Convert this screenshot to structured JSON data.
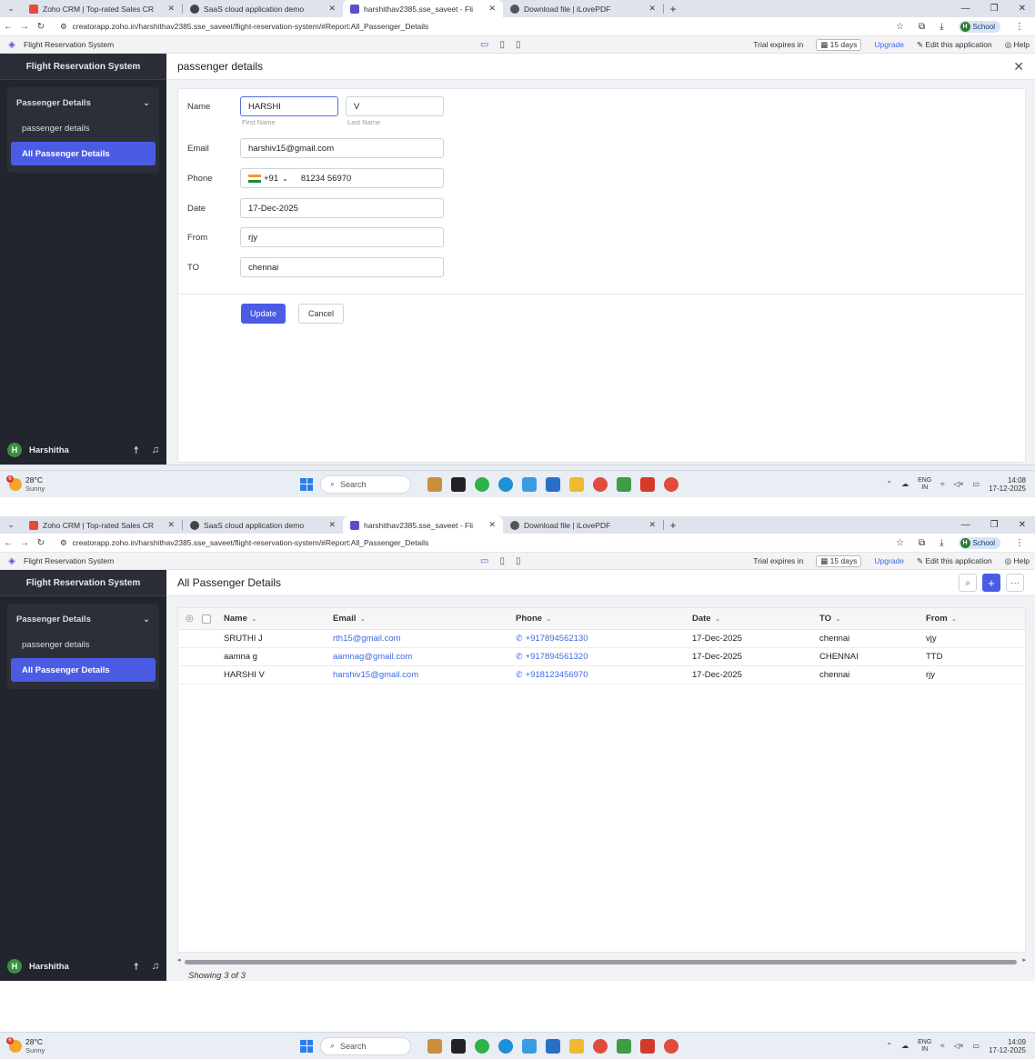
{
  "browser": {
    "tabs": [
      {
        "title": "Zoho CRM | Top-rated Sales CR",
        "color": "#e84a3a"
      },
      {
        "title": "SaaS cloud application demo",
        "color": "#444444"
      },
      {
        "title": "harshithav2385.sse_saveet - Fli",
        "color": "#5a4fcf"
      },
      {
        "title": "Download file | iLovePDF",
        "color": "#555555"
      }
    ],
    "url": "creatorapp.zoho.in/harshithav2385.sse_saveet/flight-reservation-system/#Report:All_Passenger_Details",
    "profile_label": "School",
    "profile_initial": "H"
  },
  "app": {
    "name": "Flight Reservation System",
    "trial_text": "Trial expires in",
    "trial_days": "15 days",
    "upgrade": "Upgrade",
    "edit_app": "Edit this application",
    "help": "Help"
  },
  "sidebar": {
    "title": "Flight Reservation System",
    "group": "Passenger Details",
    "items": [
      "passenger details",
      "All Passenger Details"
    ],
    "user": "Harshitha",
    "user_initial": "H"
  },
  "form": {
    "title": "passenger details",
    "labels": {
      "name": "Name",
      "email": "Email",
      "phone": "Phone",
      "date": "Date",
      "from": "From",
      "to": "TO"
    },
    "first_name": "HARSHI",
    "last_name": "V",
    "first_name_hint": "First Name",
    "last_name_hint": "Last Name",
    "email": "harshiv15@gmail.com",
    "phone_code": "+91",
    "phone": "81234 56970",
    "date": "17-Dec-2025",
    "from": "rjy",
    "to": "chennai",
    "update": "Update",
    "cancel": "Cancel"
  },
  "report": {
    "title": "All Passenger Details",
    "columns": [
      "Name",
      "Email",
      "Phone",
      "Date",
      "TO",
      "From"
    ],
    "rows": [
      {
        "name": "SRUTHI J",
        "email": "rth15@gmail.com",
        "phone": "+917894562130",
        "date": "17-Dec-2025",
        "to": "chennai",
        "from": "vjy"
      },
      {
        "name": "aamna g",
        "email": "aamnag@gmail.com",
        "phone": "+917894561320",
        "date": "17-Dec-2025",
        "to": "CHENNAI",
        "from": "TTD"
      },
      {
        "name": "HARSHI V",
        "email": "harshiv15@gmail.com",
        "phone": "+918123456970",
        "date": "17-Dec-2025",
        "to": "chennai",
        "from": "rjy"
      }
    ],
    "showing": "Showing 3 of 3"
  },
  "taskbar": {
    "temp": "28°C",
    "weather": "Sunny",
    "weather_badge": "6",
    "search": "Search",
    "lang_top": "ENG",
    "lang_bottom": "IN",
    "time1": "14:08",
    "time2": "14:09",
    "date": "17-12-2025"
  },
  "colors": {
    "accent": "#4b5ce4",
    "sidebar_bg": "#23252e",
    "link": "#3b6ae0"
  }
}
